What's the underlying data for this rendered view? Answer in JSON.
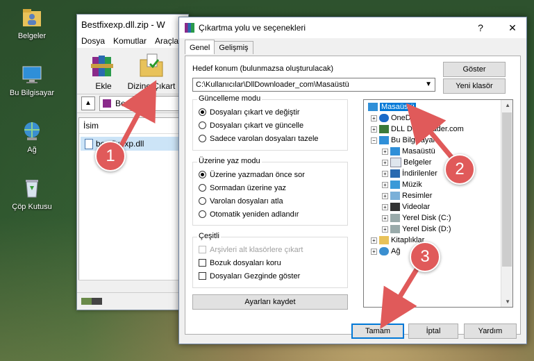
{
  "desktop": {
    "icons": [
      {
        "label": "Belgeler",
        "icon": "folder-user-icon"
      },
      {
        "label": "Bu Bilgisayar",
        "icon": "computer-icon"
      },
      {
        "label": "Ağ",
        "icon": "network-icon"
      },
      {
        "label": "Çöp Kutusu",
        "icon": "recycle-bin-icon"
      }
    ]
  },
  "winrar": {
    "title": "Bestfixexp.dll.zip - W",
    "menu": [
      "Dosya",
      "Komutlar",
      "Araçla"
    ],
    "tools": [
      {
        "label": "Ekle"
      },
      {
        "label": "Dizine Çıkart"
      }
    ],
    "address": "Bestfixexp.",
    "column": "İsim",
    "file": "bestfixexp.dll"
  },
  "dialog": {
    "title": "Çıkartma yolu ve seçenekleri",
    "help": "?",
    "close": "✕",
    "tabs": [
      "Genel",
      "Gelişmiş"
    ],
    "dest_label": "Hedef konum (bulunmazsa oluşturulacak)",
    "dest_value": "C:\\Kullanıcılar\\DllDownloader_com\\Masaüstü",
    "show_button": "Göster",
    "new_folder_button": "Yeni klasör",
    "update_group": {
      "title": "Güncelleme modu",
      "options": [
        "Dosyaları çıkart ve değiştir",
        "Dosyaları çıkart ve güncelle",
        "Sadece varolan dosyaları tazele"
      ],
      "selected": 0
    },
    "overwrite_group": {
      "title": "Üzerine yaz modu",
      "options": [
        "Üzerine yazmadan önce sor",
        "Sormadan üzerine yaz",
        "Varolan dosyaları atla",
        "Otomatik yeniden adlandır"
      ],
      "selected": 0
    },
    "misc_group": {
      "title": "Çeşitli",
      "options": [
        "Arşivleri alt klasörlere çıkart",
        "Bozuk dosyaları koru",
        "Dosyaları Gezginde göster"
      ]
    },
    "save_button": "Ayarları kaydet",
    "tree": {
      "items": [
        "Masaüstü",
        "OneDrive",
        "DLL Downloader.com",
        "Bu Bilgisayar",
        "Masaüstü",
        "Belgeler",
        "İndirilenler",
        "Müzik",
        "Resimler",
        "Videolar",
        "Yerel Disk (C:)",
        "Yerel Disk (D:)",
        "Kitaplıklar",
        "Ağ"
      ]
    },
    "ok_button": "Tamam",
    "cancel_button": "İptal",
    "help_button": "Yardım"
  },
  "annotations": [
    "1",
    "2",
    "3"
  ],
  "colors": {
    "accent": "#0078d7",
    "badge": "#e05a5a"
  }
}
